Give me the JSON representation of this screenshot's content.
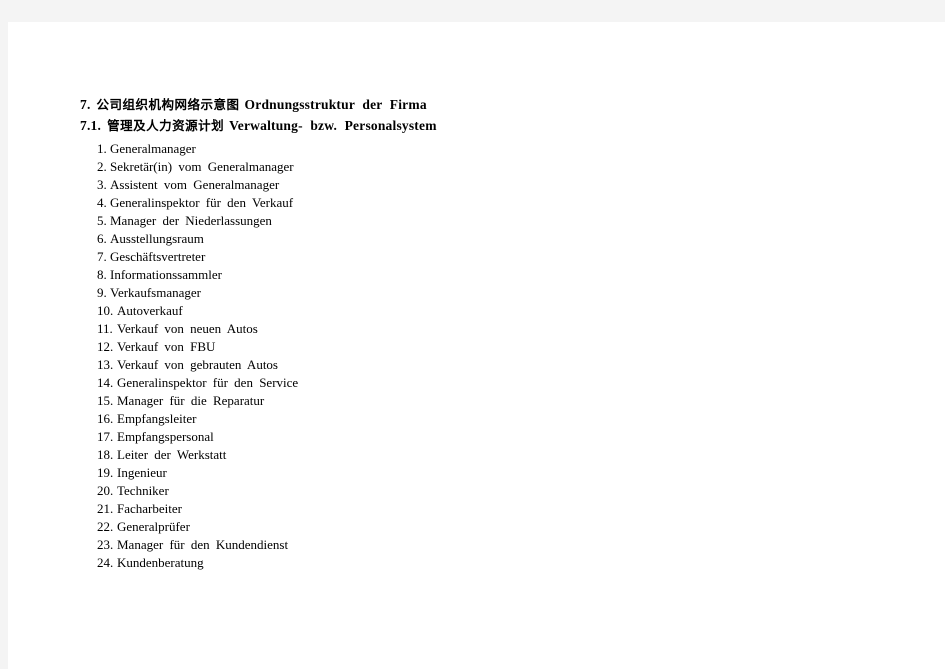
{
  "page": {
    "background_color": "#f4f4f4",
    "paper_color": "#ffffff"
  },
  "headings": [
    {
      "number": "7.",
      "cjk_title": "公司组织机构网络示意图",
      "latin_title": "Ordnungsstruktur der Firma"
    },
    {
      "number": "7.1.",
      "cjk_title": "管理及人力资源计划",
      "latin_title": "Verwaltung- bzw. Personalsystem"
    }
  ],
  "list": {
    "items": [
      {
        "index": "1.",
        "label": "Generalmanager"
      },
      {
        "index": "2.",
        "label": "Sekretär(in) vom Generalmanager"
      },
      {
        "index": "3.",
        "label": "Assistent vom Generalmanager"
      },
      {
        "index": "4.",
        "label": "Generalinspektor für den Verkauf"
      },
      {
        "index": "5.",
        "label": "Manager der Niederlassungen"
      },
      {
        "index": "6.",
        "label": "Ausstellungsraum"
      },
      {
        "index": "7.",
        "label": "Geschäftsvertreter"
      },
      {
        "index": "8.",
        "label": "Informationssammler"
      },
      {
        "index": "9.",
        "label": "Verkaufsmanager"
      },
      {
        "index": "10.",
        "label": "Autoverkauf"
      },
      {
        "index": "11.",
        "label": "Verkauf von neuen Autos"
      },
      {
        "index": "12.",
        "label": "Verkauf von FBU"
      },
      {
        "index": "13.",
        "label": "Verkauf von gebrauten Autos"
      },
      {
        "index": "14.",
        "label": "Generalinspektor für den Service"
      },
      {
        "index": "15.",
        "label": "Manager für die Reparatur"
      },
      {
        "index": "16.",
        "label": "Empfangsleiter"
      },
      {
        "index": "17.",
        "label": "Empfangspersonal"
      },
      {
        "index": "18.",
        "label": "Leiter der Werkstatt"
      },
      {
        "index": "19.",
        "label": "Ingenieur"
      },
      {
        "index": "20.",
        "label": "Techniker"
      },
      {
        "index": "21.",
        "label": "Facharbeiter"
      },
      {
        "index": "22.",
        "label": "Generalprüfer"
      },
      {
        "index": "23.",
        "label": "Manager für den Kundendienst"
      },
      {
        "index": "24.",
        "label": "Kundenberatung"
      }
    ]
  }
}
